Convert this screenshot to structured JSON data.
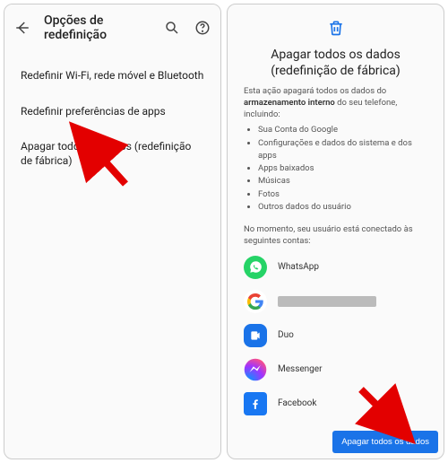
{
  "left": {
    "title": "Opções de redefinição",
    "options": [
      "Redefinir Wi-Fi, rede móvel e Bluetooth",
      "Redefinir preferências de apps",
      "Apagar todos os dados (redefinição de fábrica)"
    ]
  },
  "right": {
    "title": "Apagar todos os dados (redefinição de fábrica)",
    "desc_pre": "Esta ação apagará todos os dados do ",
    "desc_bold": "armazenamento interno",
    "desc_post": " do seu telefone, incluindo:",
    "bullets": [
      "Sua Conta do Google",
      "Configurações e dados do sistema e dos apps",
      "Apps baixados",
      "Músicas",
      "Fotos",
      "Outros dados do usuário"
    ],
    "subdesc": "No momento, seu usuário está conectado às seguintes contas:",
    "accounts": [
      {
        "name": "WhatsApp"
      },
      {
        "name": ""
      },
      {
        "name": "Duo"
      },
      {
        "name": "Messenger"
      },
      {
        "name": "Facebook"
      }
    ],
    "button": "Apagar todos os dados"
  }
}
